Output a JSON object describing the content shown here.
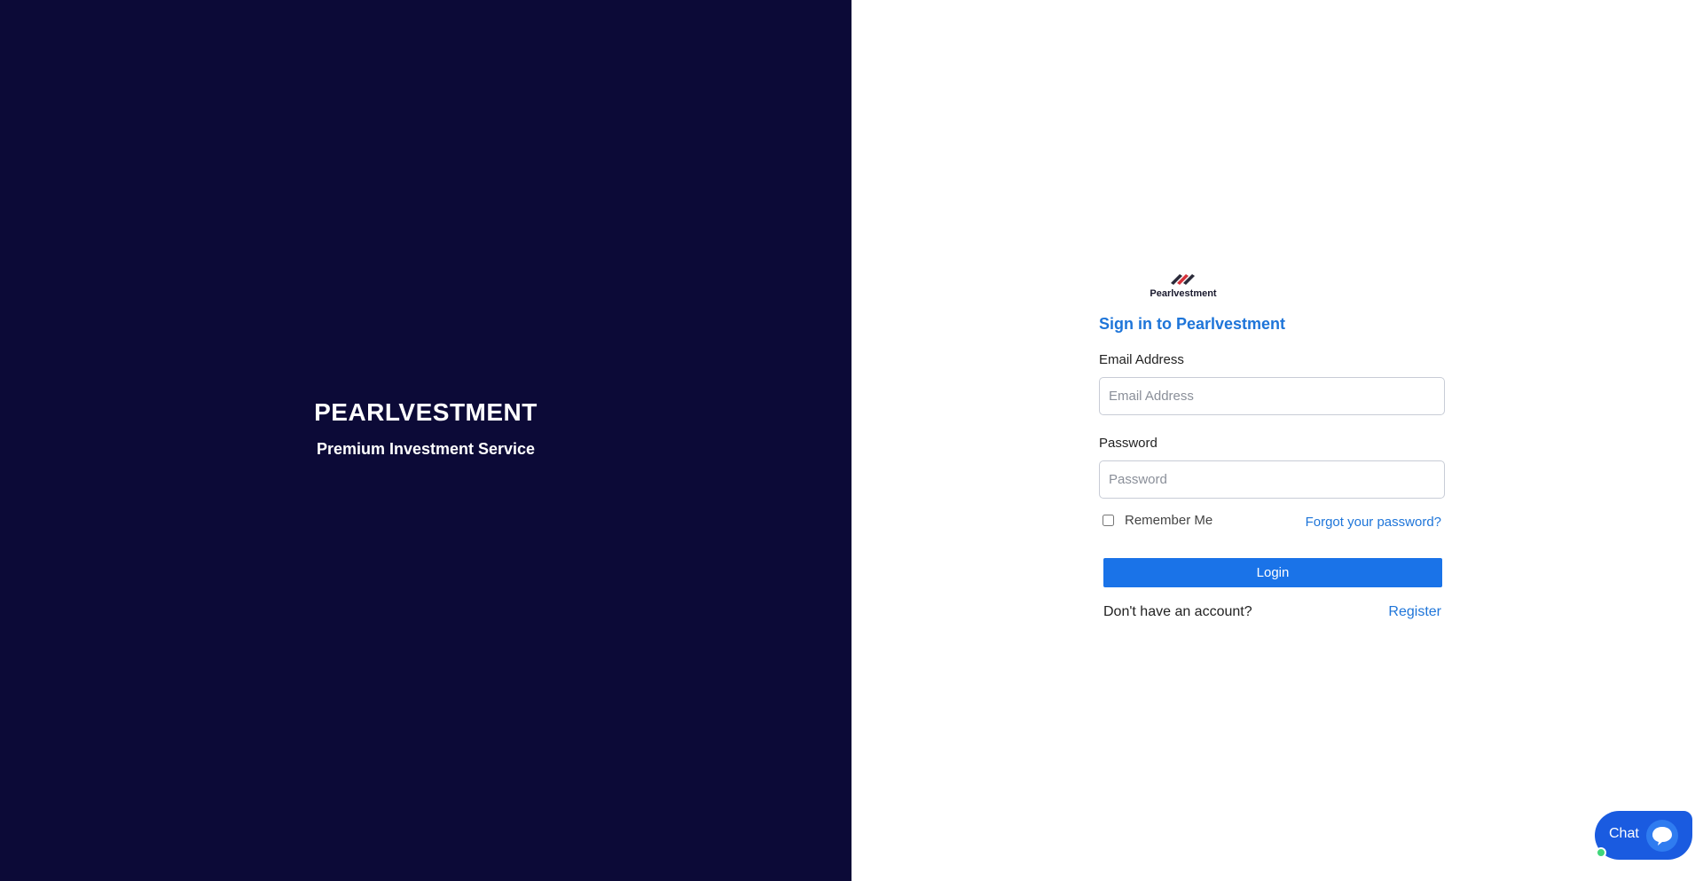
{
  "brand": {
    "title": "PEARLVESTMENT",
    "subtitle": "Premium Investment Service"
  },
  "logo": {
    "text": "Pearlvestment",
    "icon": "pearlvestment-logo-icon"
  },
  "form": {
    "heading": "Sign in to Pearlvestment",
    "email_label": "Email Address",
    "email_placeholder": "Email Address",
    "email_value": "",
    "password_label": "Password",
    "password_placeholder": "Password",
    "password_value": "",
    "remember_label": "Remember Me",
    "remember_checked": false,
    "forgot_link": "Forgot your password?",
    "login_button": "Login",
    "no_account_text": "Don't have an account?",
    "register_link": "Register"
  },
  "chat": {
    "label": "Chat",
    "icon": "chat-bubble-icon",
    "status": "online"
  },
  "colors": {
    "left_panel_bg": "#0c0a37",
    "accent": "#1a73e8",
    "link": "#1e75d9",
    "chat_bg": "#1a5be0",
    "online_dot": "#3fd67a"
  }
}
